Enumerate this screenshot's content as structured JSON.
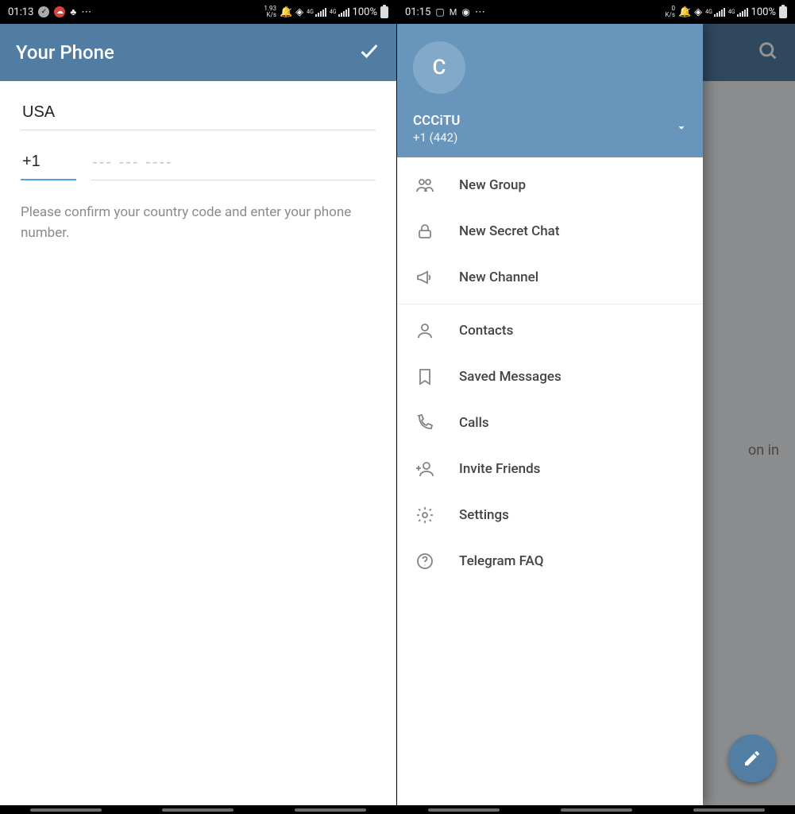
{
  "left": {
    "status": {
      "time": "01:13",
      "speed_top": "1.93",
      "speed_unit": "K/s",
      "net1": "4G",
      "net2": "4G",
      "battery": "100%"
    },
    "appbar_title": "Your Phone",
    "country": "USA",
    "dial_code": "+1",
    "phone_placeholder": "--- --- ----",
    "help": "Please confirm your country code and enter your phone number."
  },
  "right": {
    "status": {
      "time": "01:15",
      "speed_top": "0",
      "speed_unit": "K/s",
      "net1": "4G",
      "net2": "4G",
      "battery": "100%"
    },
    "underlay_text": "on in",
    "drawer": {
      "avatar_initial": "C",
      "name": "CCCiTU",
      "phone": "+1 (442)",
      "groups": [
        [
          {
            "id": "new-group",
            "label": "New Group"
          },
          {
            "id": "new-secret-chat",
            "label": "New Secret Chat"
          },
          {
            "id": "new-channel",
            "label": "New Channel"
          }
        ],
        [
          {
            "id": "contacts",
            "label": "Contacts"
          },
          {
            "id": "saved-messages",
            "label": "Saved Messages"
          },
          {
            "id": "calls",
            "label": "Calls"
          },
          {
            "id": "invite-friends",
            "label": "Invite Friends"
          },
          {
            "id": "settings",
            "label": "Settings"
          },
          {
            "id": "telegram-faq",
            "label": "Telegram FAQ"
          }
        ]
      ]
    }
  }
}
